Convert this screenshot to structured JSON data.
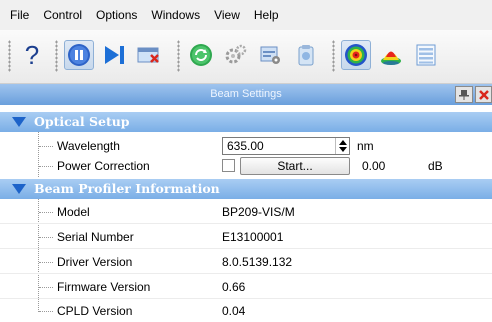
{
  "menu": [
    "File",
    "Control",
    "Options",
    "Windows",
    "View",
    "Help"
  ],
  "toolbar": {
    "buttons": [
      "help-icon",
      "pause-icon",
      "step-forward-icon",
      "window-close-icon",
      "refresh-icon",
      "settings-icon",
      "image-settings-icon",
      "clipboard-icon",
      "target-icon",
      "cone-icon",
      "list-icon"
    ],
    "active_pause": true
  },
  "panel": {
    "title": "Beam Settings"
  },
  "optical_setup": {
    "title": "Optical Setup",
    "wavelength_label": "Wavelength",
    "wavelength_value": "635.00",
    "wavelength_unit": "nm",
    "power_correction_label": "Power Correction",
    "power_correction_checked": false,
    "start_button": "Start...",
    "power_value": "0.00",
    "power_unit": "dB"
  },
  "profiler_info": {
    "title": "Beam Profiler Information",
    "rows": [
      {
        "label": "Model",
        "value": "BP209-VIS/M"
      },
      {
        "label": "Serial Number",
        "value": "E13100001"
      },
      {
        "label": "Driver Version",
        "value": "8.0.5139.132"
      },
      {
        "label": "Firmware Version",
        "value": "0.66"
      },
      {
        "label": "CPLD Version",
        "value": "0.04"
      }
    ]
  },
  "colors": {
    "header_blue": "#6a9fdc",
    "section_blue": "#7aaee6",
    "triangle_blue": "#1d63c9"
  }
}
